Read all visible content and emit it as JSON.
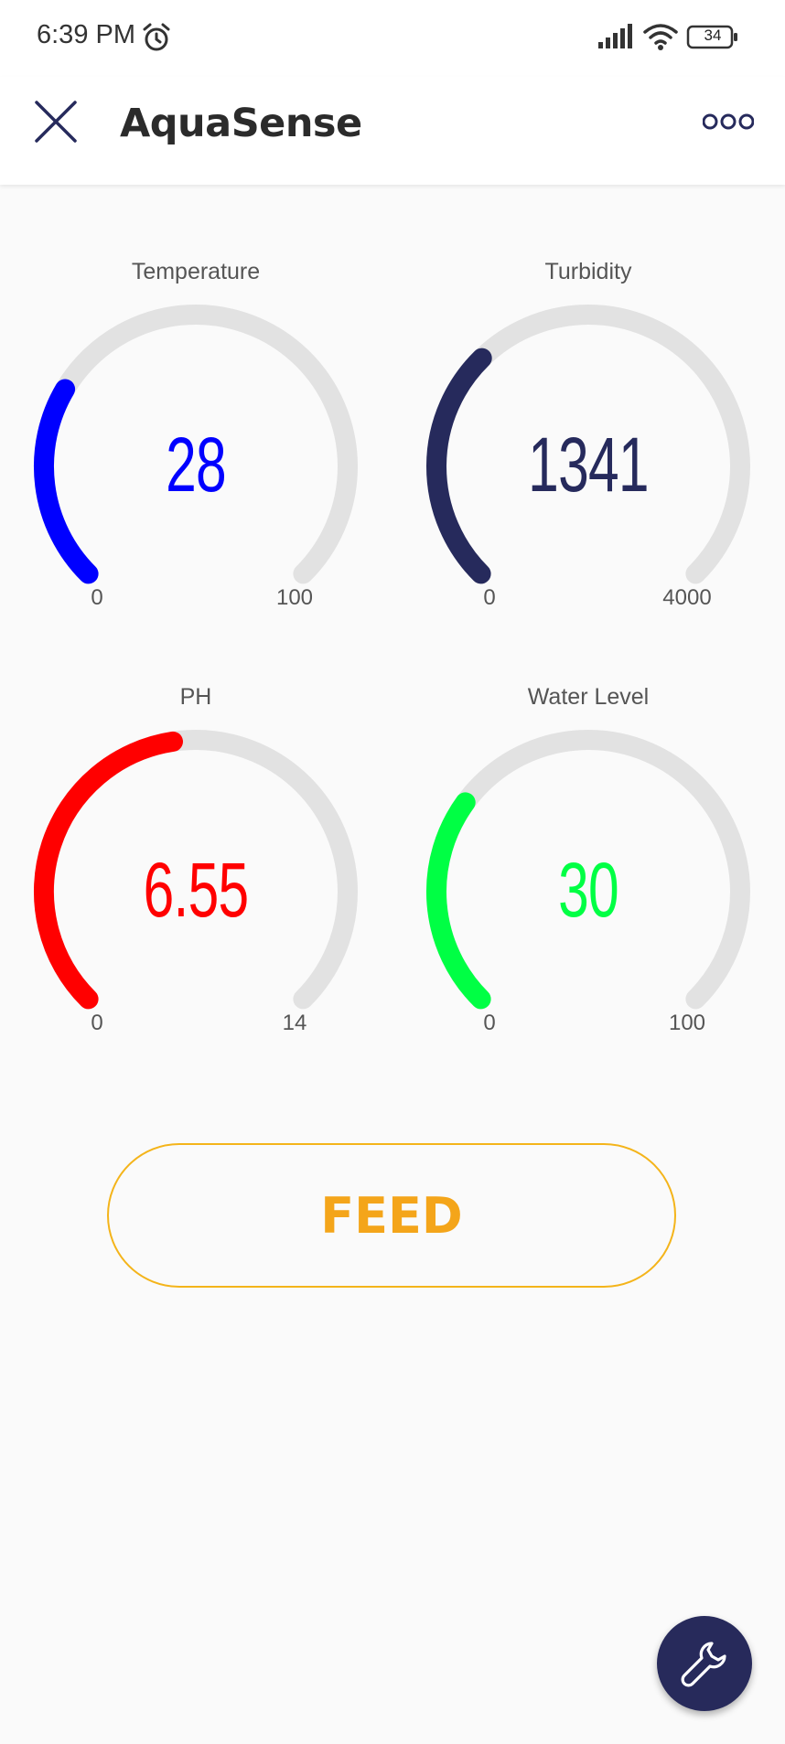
{
  "status": {
    "time": "6:39 PM",
    "battery": "34"
  },
  "app_bar": {
    "title": "AquaSense"
  },
  "gauges": [
    {
      "label": "Temperature",
      "value": "28",
      "value_num": 28,
      "min": "0",
      "max": "100",
      "min_num": 0,
      "max_num": 100,
      "color": "#0000ff"
    },
    {
      "label": "Turbidity",
      "value": "1341",
      "value_num": 1341,
      "min": "0",
      "max": "4000",
      "min_num": 0,
      "max_num": 4000,
      "color": "#262a5c"
    },
    {
      "label": "PH",
      "value": "6.55",
      "value_num": 6.55,
      "min": "0",
      "max": "14",
      "min_num": 0,
      "max_num": 14,
      "color": "#ff0000"
    },
    {
      "label": "Water Level",
      "value": "30",
      "value_num": 30,
      "min": "0",
      "max": "100",
      "min_num": 0,
      "max_num": 100,
      "color": "#00ff44"
    }
  ],
  "feed_button": {
    "label": "FEED"
  },
  "colors": {
    "accent": "#f4a51a",
    "fab": "#272a5b",
    "track": "#e2e2e2"
  },
  "icons": {
    "close": "close-icon",
    "more": "more-icon",
    "fab": "wrench-icon"
  }
}
